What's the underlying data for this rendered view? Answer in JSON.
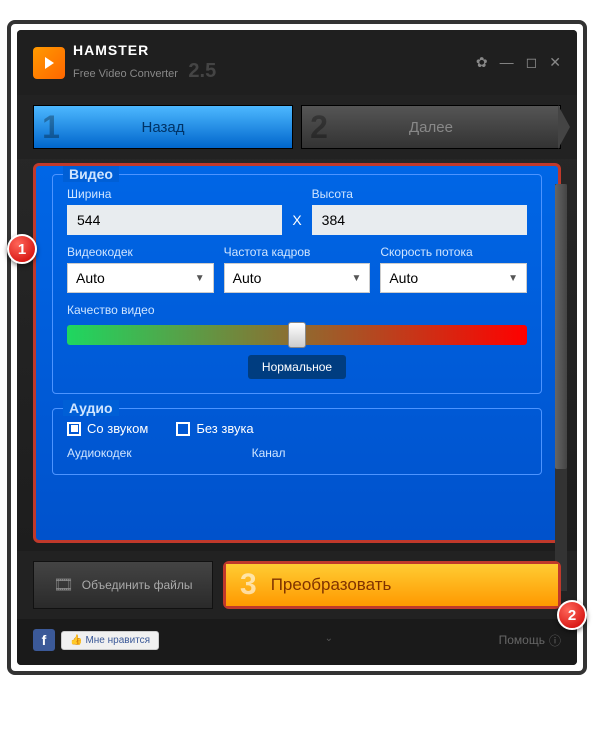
{
  "title": {
    "name": "HAMSTER",
    "subtitle": "Free Video Converter",
    "version": "2.5"
  },
  "steps": {
    "back": "Назад",
    "next": "Далее"
  },
  "video": {
    "legend": "Видео",
    "width_label": "Ширина",
    "width": "544",
    "height_label": "Высота",
    "height": "384",
    "codec_label": "Видеокодек",
    "codec": "Auto",
    "fps_label": "Частота кадров",
    "fps": "Auto",
    "bitrate_label": "Скорость потока",
    "bitrate": "Auto",
    "quality_label": "Качество видео",
    "quality_value": "Нормальное"
  },
  "audio": {
    "legend": "Аудио",
    "with_sound": "Со звуком",
    "no_sound": "Без звука",
    "codec_label": "Аудиокодек",
    "channel_label": "Канал"
  },
  "bottom": {
    "merge": "Объединить файлы",
    "convert": "Преобразовать"
  },
  "footer": {
    "like": "Мне нравится",
    "help": "Помощь"
  },
  "callouts": {
    "one": "1",
    "two": "2"
  }
}
